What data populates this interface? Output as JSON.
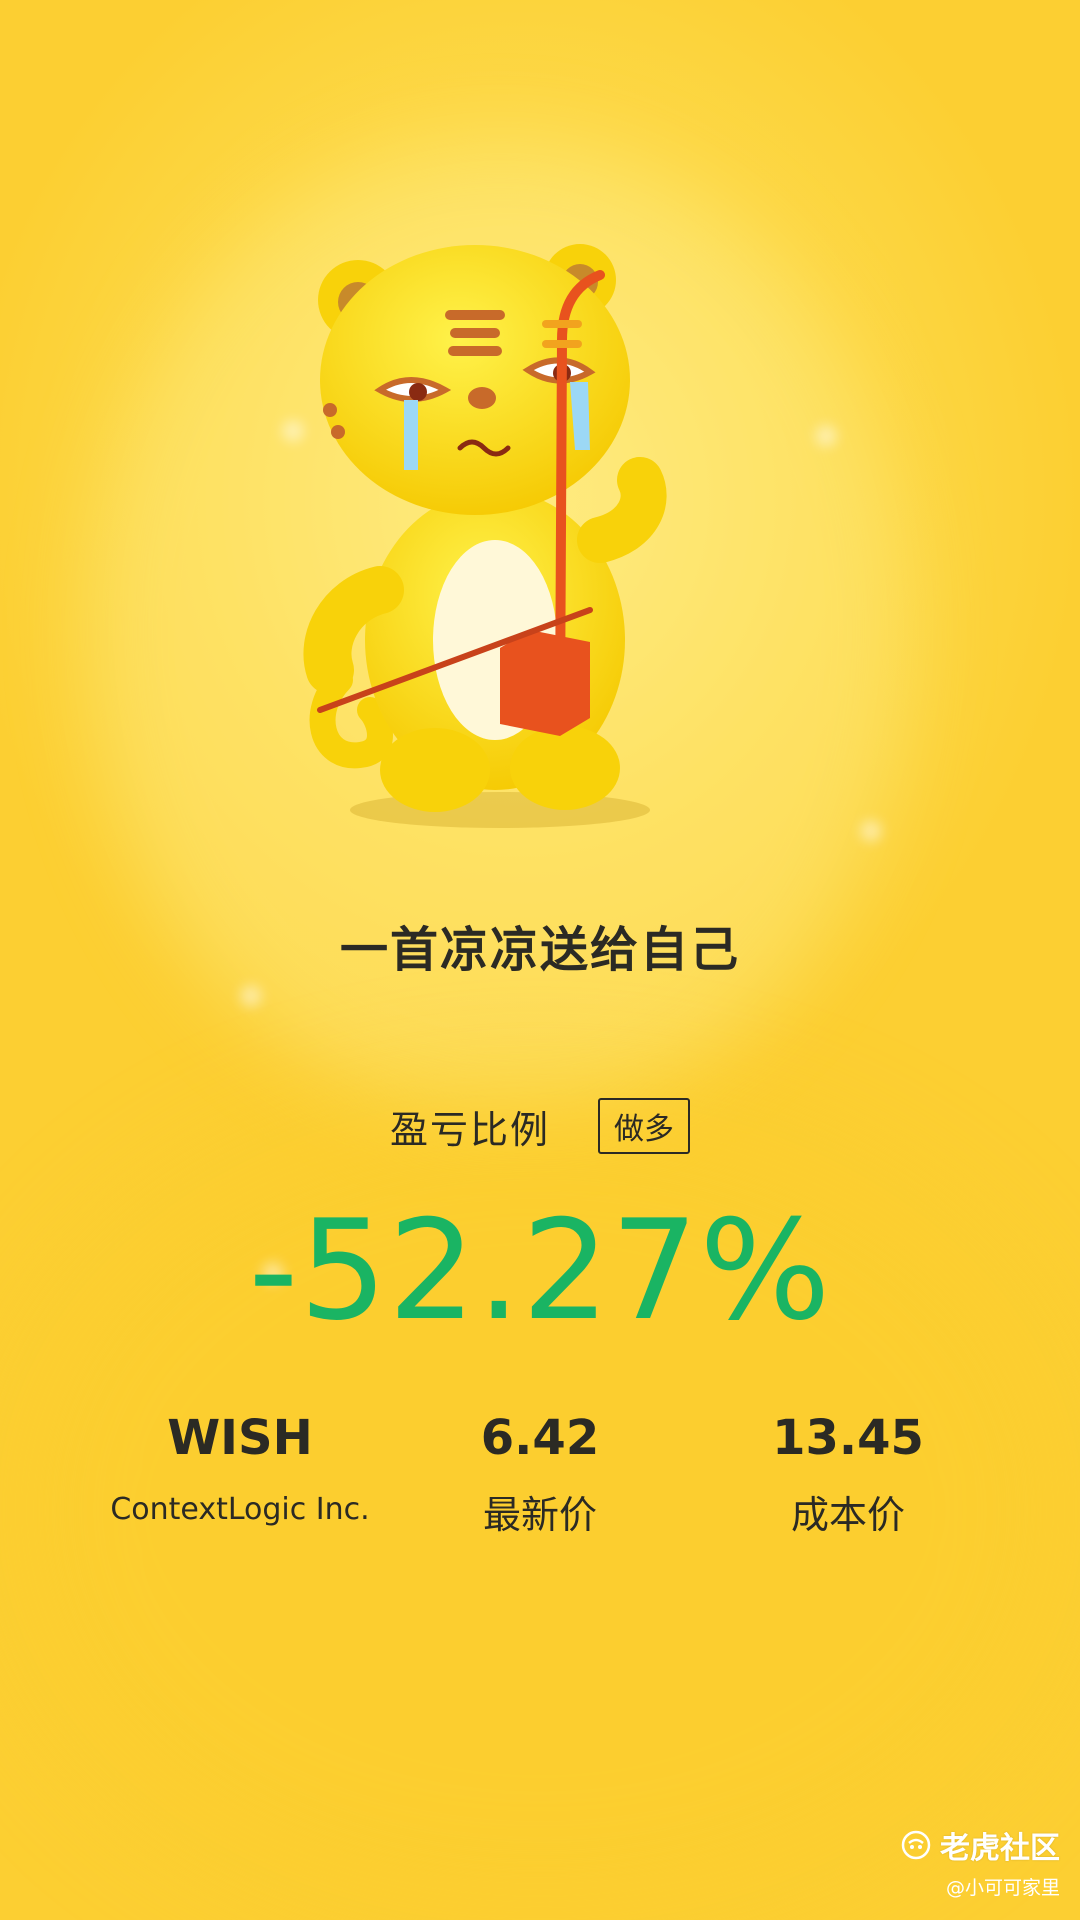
{
  "headline": "一首凉凉送给自己",
  "pnl": {
    "label": "盈亏比例",
    "badge": "做多",
    "percent": "-52.27%",
    "percent_color": "#1AB463"
  },
  "stock": {
    "symbol": "WISH",
    "company": "ContextLogic Inc.",
    "latest_price": "6.42",
    "latest_price_label": "最新价",
    "cost_price": "13.45",
    "cost_price_label": "成本价"
  },
  "watermark": {
    "brand": "老虎社区",
    "user": "@小可可家里",
    "icon": "tiger-community-logo-icon"
  },
  "mascot": {
    "icon": "crying-tiger-erhu-mascot-icon"
  },
  "colors": {
    "background": "#FCCF32",
    "text": "#2b2a24",
    "loss": "#1AB463"
  }
}
